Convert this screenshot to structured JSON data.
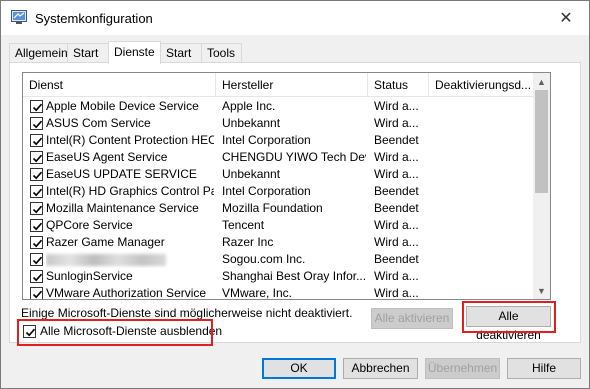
{
  "window": {
    "title": "Systemkonfiguration",
    "close_glyph": "✕"
  },
  "tabs": [
    {
      "label": "Allgemein",
      "active": false
    },
    {
      "label": "Start",
      "active": false
    },
    {
      "label": "Dienste",
      "active": true
    },
    {
      "label": "Start",
      "active": false
    },
    {
      "label": "Tools",
      "active": false
    }
  ],
  "services": {
    "columns": [
      "Dienst",
      "Hersteller",
      "Status",
      "Deaktivierungsd..."
    ],
    "rows": [
      {
        "name": "Apple Mobile Device Service",
        "vendor": "Apple Inc.",
        "status": "Wird a...",
        "checked": true
      },
      {
        "name": "ASUS Com Service",
        "vendor": "Unbekannt",
        "status": "Wird a...",
        "checked": true
      },
      {
        "name": "Intel(R) Content Protection HEC...",
        "vendor": "Intel Corporation",
        "status": "Beendet",
        "checked": true
      },
      {
        "name": "EaseUS Agent Service",
        "vendor": "CHENGDU YIWO Tech Dev...",
        "status": "Wird a...",
        "checked": true
      },
      {
        "name": "EaseUS UPDATE SERVICE",
        "vendor": "Unbekannt",
        "status": "Wird a...",
        "checked": true
      },
      {
        "name": "Intel(R) HD Graphics Control Pa...",
        "vendor": "Intel Corporation",
        "status": "Beendet",
        "checked": true
      },
      {
        "name": "Mozilla Maintenance Service",
        "vendor": "Mozilla Foundation",
        "status": "Beendet",
        "checked": true
      },
      {
        "name": "QPCore Service",
        "vendor": "Tencent",
        "status": "Wird a...",
        "checked": true
      },
      {
        "name": "Razer Game Manager",
        "vendor": "Razer Inc",
        "status": "Wird a...",
        "checked": true
      },
      {
        "name": "",
        "vendor": "Sogou.com Inc.",
        "status": "Beendet",
        "checked": true,
        "redacted": true
      },
      {
        "name": "SunloginService",
        "vendor": "Shanghai Best Oray Infor...",
        "status": "Wird a...",
        "checked": true
      },
      {
        "name": "VMware Authorization Service",
        "vendor": "VMware, Inc.",
        "status": "Wird a...",
        "checked": true
      }
    ]
  },
  "note_text": "Einige Microsoft-Dienste sind möglicherweise nicht deaktiviert.",
  "buttons": {
    "enable_all": "Alle aktivieren",
    "disable_all": "Alle deaktivieren",
    "ok": "OK",
    "cancel": "Abbrechen",
    "apply": "Übernehmen",
    "help": "Hilfe"
  },
  "hide_ms_services": {
    "label": "Alle Microsoft-Dienste ausblenden",
    "checked": true
  },
  "colors": {
    "highlight_box": "#e02020",
    "default_button_border": "#0078d7"
  }
}
